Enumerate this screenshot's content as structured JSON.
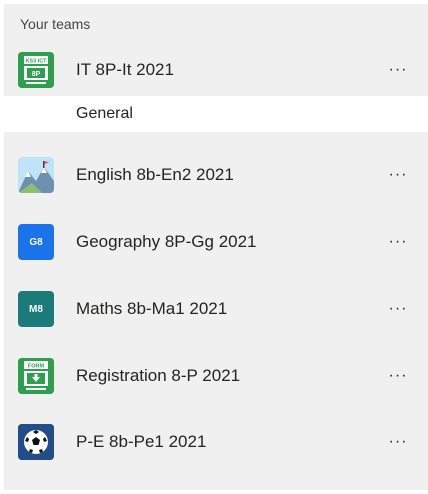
{
  "sidebar": {
    "section_title": "Your teams",
    "teams": [
      {
        "name": "IT 8P-It 2021",
        "icon": "ks3-ict-icon",
        "icon_text": "KS3 ICT",
        "icon_sub": "8P",
        "more": "···"
      },
      {
        "name": "English 8b-En2 2021",
        "icon": "mountain-landscape-icon",
        "more": "···"
      },
      {
        "name": "Geography 8P-Gg 2021",
        "icon_text": "G8",
        "icon_color": "#1a73e8",
        "more": "···"
      },
      {
        "name": "Maths 8b-Ma1 2021",
        "icon_text": "M8",
        "icon_color": "#1b7a7a",
        "more": "···"
      },
      {
        "name": "Registration 8-P 2021",
        "icon": "form-icon",
        "icon_text": "FORM",
        "more": "···"
      },
      {
        "name": "P-E 8b-Pe1 2021",
        "icon": "soccer-ball-icon",
        "more": "···"
      }
    ],
    "channels": [
      {
        "label": "General"
      }
    ]
  },
  "colors": {
    "panel_bg": "#f0f0f0",
    "selected_channel_bg": "#ffffff",
    "green_tile": "#2e9e4f",
    "blue_tile": "#1a73e8",
    "teal_tile": "#1b7a7a",
    "navy_tile": "#1f4e8a"
  }
}
